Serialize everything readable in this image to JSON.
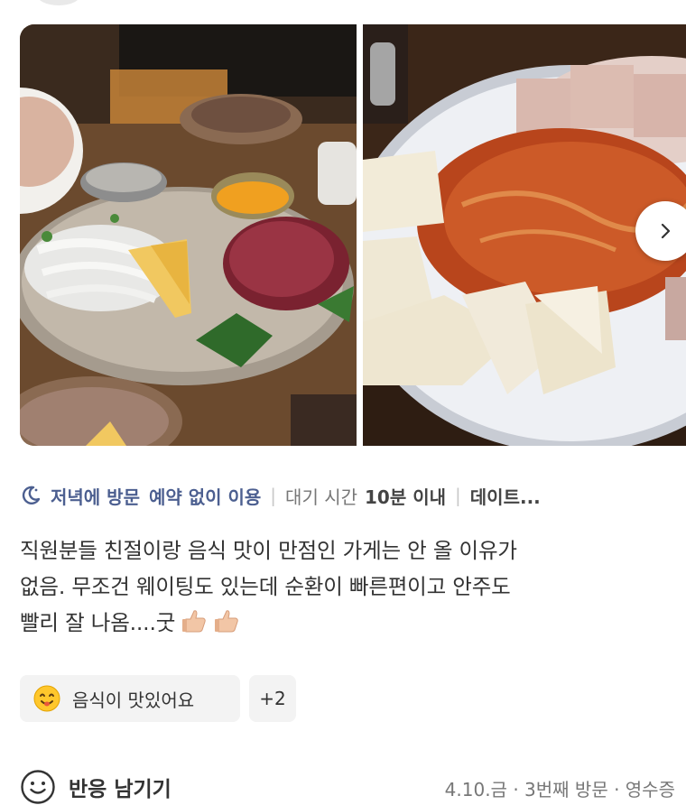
{
  "photos": [
    {
      "alt": "beef tartare platter"
    },
    {
      "alt": "tofu kimchi"
    }
  ],
  "visit_info": {
    "time": "저녁에 방문",
    "reservation": "예약 없이 이용",
    "wait_label": "대기 시간",
    "wait_value": "10분 이내",
    "purpose": "데이트..."
  },
  "review": {
    "line1": "직원분들 친절이랑 음식 맛이 만점인 가게는 안 올 이유가",
    "line2": "없음. 무조건 웨이팅도 있는데 순환이 빠른편이고 안주도",
    "line3": "빨리 잘 나옴....굿"
  },
  "keywords": {
    "first": "음식이 맛있어요",
    "more": "+2"
  },
  "footer": {
    "react_label": "반응 남기기",
    "meta": "4.10.금 · 3번째 방문 · 영수증"
  }
}
